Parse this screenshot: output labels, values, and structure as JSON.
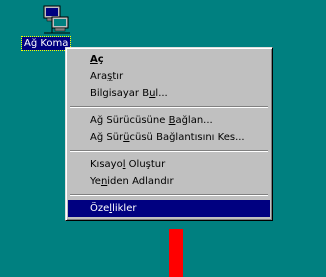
{
  "desktop": {
    "background_color": "#008080",
    "icon": {
      "name": "network-computers-icon",
      "label": "Ağ Koma"
    }
  },
  "context_menu": {
    "items": [
      {
        "label": "Aç",
        "pre": "",
        "key": "A",
        "post": "ç",
        "default": true
      },
      {
        "label": "Araştır",
        "pre": "Ara",
        "key": "ş",
        "post": "tır"
      },
      {
        "label": "Bilgisayar Bul...",
        "pre": "Bilgisayar B",
        "key": "u",
        "post": "l..."
      },
      {
        "separator": true
      },
      {
        "label": "Ağ Sürücüsüne Bağlan...",
        "pre": "Ağ Sürücüsüne ",
        "key": "B",
        "post": "ağlan..."
      },
      {
        "label": "Ağ Sürücüsü Bağlantısını Kes...",
        "pre": "Ağ Sür",
        "key": "ü",
        "post": "cüsü Bağlantısını Kes..."
      },
      {
        "separator": true
      },
      {
        "label": "Kısayol Oluştur",
        "pre": "Kısayo",
        "key": "l",
        "post": " Oluştur"
      },
      {
        "label": "Yeniden Adlandır",
        "pre": "Ye",
        "key": "n",
        "post": "iden Adlandır"
      },
      {
        "separator": true
      },
      {
        "label": "Özellikler",
        "pre": "Öze",
        "key": "l",
        "post": "likler",
        "highlighted": true
      }
    ]
  },
  "highlight_color": "#000080",
  "pointer_color": "#ff0000"
}
